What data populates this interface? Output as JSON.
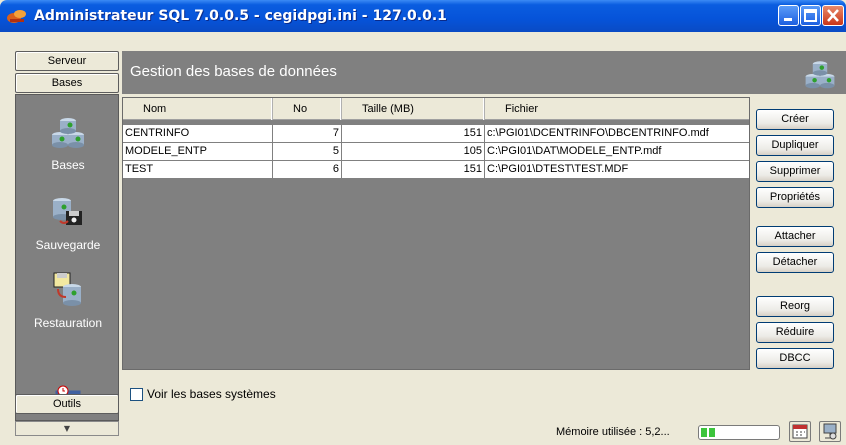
{
  "window": {
    "title": "Administrateur SQL 7.0.0.5 - cegidpgi.ini - 127.0.0.1"
  },
  "leftbar": {
    "group_top": "Serveur",
    "group_active": "Bases",
    "group_bottom": "Outils",
    "items": [
      {
        "label": "Bases",
        "icon": "database-icon"
      },
      {
        "label": "Sauvegarde",
        "icon": "backup-icon"
      },
      {
        "label": "Restauration",
        "icon": "restore-icon"
      },
      {
        "label": "",
        "icon": "scheduler-icon"
      }
    ]
  },
  "header": {
    "title": "Gestion des bases de données",
    "icon": "databases-icon"
  },
  "table": {
    "columns": [
      "Nom",
      "No",
      "Taille (MB)",
      "Fichier"
    ],
    "rows": [
      {
        "nom": "CENTRINFO",
        "no": "7",
        "taille": "151",
        "fichier": "c:\\PGI01\\DCENTRINFO\\DBCENTRINFO.mdf"
      },
      {
        "nom": "MODELE_ENTP",
        "no": "5",
        "taille": "105",
        "fichier": "C:\\PGI01\\DAT\\MODELE_ENTP.mdf"
      },
      {
        "nom": "TEST",
        "no": "6",
        "taille": "151",
        "fichier": "C:\\PGI01\\DTEST\\TEST.MDF"
      }
    ]
  },
  "actions": {
    "creer": "Créer",
    "dupliquer": "Dupliquer",
    "supprimer": "Supprimer",
    "proprietes": "Propriétés",
    "attacher": "Attacher",
    "detacher": "Détacher",
    "reorg": "Reorg",
    "reduire": "Réduire",
    "dbcc": "DBCC"
  },
  "options": {
    "voir_bases_systemes": "Voir les bases systèmes",
    "voir_bases_systemes_checked": false
  },
  "status": {
    "memory_label": "Mémoire utilisée : 5,2...",
    "memory_fraction": 0.2
  },
  "colors": {
    "titlebar": "#0653d9",
    "panel": "#808080",
    "accent_green": "#3cc43c"
  }
}
